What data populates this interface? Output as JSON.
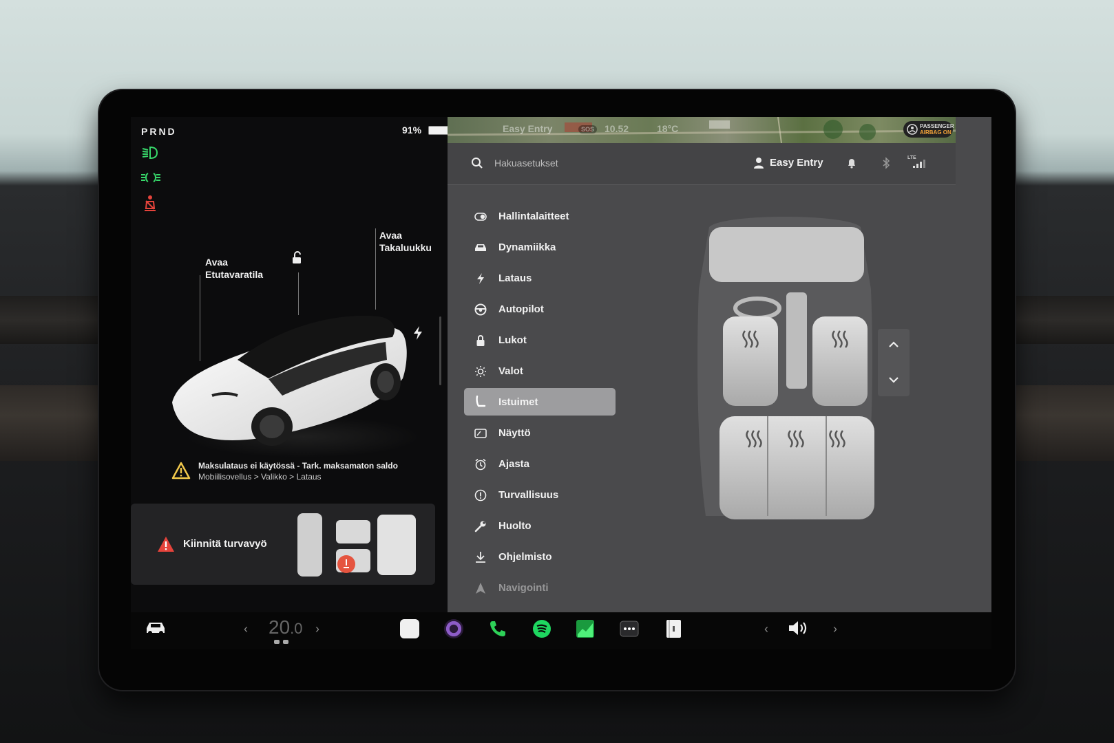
{
  "status": {
    "gear": "PRND",
    "battery_percent": "91%",
    "battery_level": 0.91
  },
  "indicators": [
    "low-beam-icon",
    "parking-lights-icon",
    "seatbelt-warning-icon"
  ],
  "car_view": {
    "frunk_label_1": "Avaa",
    "frunk_label_2": "Etutavaratila",
    "trunk_label_1": "Avaa",
    "trunk_label_2": "Takaluukku"
  },
  "notice": {
    "line1": "Maksulataus ei käytössä - Tark. maksamaton saldo",
    "line2": "Mobiilisovellus > Valikko > Lataus"
  },
  "seatbelt_alert": {
    "text": "Kiinnitä turvavyö"
  },
  "map_bar": {
    "profile": "Easy Entry",
    "time": "10.52",
    "temperature": "18°C",
    "sos": "SOS",
    "airbag_line1": "PASSENGER",
    "airbag_line2": "AIRBAG ON"
  },
  "top_bar": {
    "search_placeholder": "Hakuasetukset",
    "profile_name": "Easy Entry",
    "network": "LTE"
  },
  "menu": [
    {
      "label": "Hallintalaitteet",
      "icon": "toggle-icon"
    },
    {
      "label": "Dynamiikka",
      "icon": "car-icon"
    },
    {
      "label": "Lataus",
      "icon": "bolt-icon"
    },
    {
      "label": "Autopilot",
      "icon": "steering-wheel-icon"
    },
    {
      "label": "Lukot",
      "icon": "lock-icon"
    },
    {
      "label": "Valot",
      "icon": "sun-icon"
    },
    {
      "label": "Istuimet",
      "icon": "seat-icon",
      "active": true
    },
    {
      "label": "Näyttö",
      "icon": "display-icon"
    },
    {
      "label": "Ajasta",
      "icon": "alarm-clock-icon"
    },
    {
      "label": "Turvallisuus",
      "icon": "alert-circle-icon"
    },
    {
      "label": "Huolto",
      "icon": "wrench-icon"
    },
    {
      "label": "Ohjelmisto",
      "icon": "download-icon"
    },
    {
      "label": "Navigointi",
      "icon": "navigation-icon"
    }
  ],
  "dock": {
    "temperature": "20",
    "temperature_decimal": ".0",
    "apps": [
      "notes-icon",
      "camera-icon",
      "phone-icon",
      "spotify-icon",
      "energy-icon",
      "more-icon",
      "manual-icon"
    ],
    "volume_icon": "volume-icon"
  },
  "colors": {
    "indicator_green": "#37d86a",
    "warning_red": "#e5433b",
    "active_menu": "#9d9d9f"
  }
}
